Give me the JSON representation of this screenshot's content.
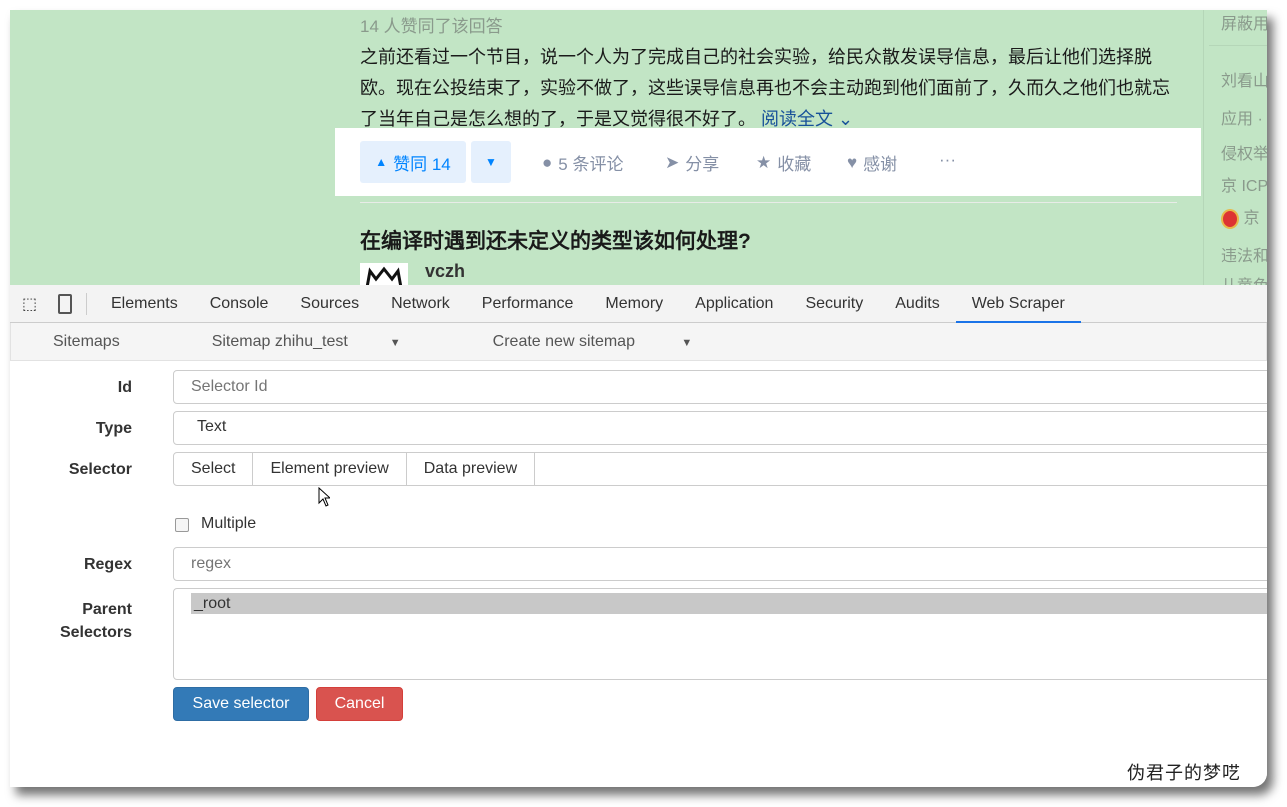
{
  "answer": {
    "likes_text": "14 人赞同了该回答",
    "excerpt": "之前还看过一个节目，说一个人为了完成自己的社会实验，给民众散发误导信息，最后让他们选择脱欧。现在公投结束了，实验不做了，这些误导信息再也不会主动跑到他们面前了，久而久之他们也就忘了当年自己是怎么想的了，于是又觉得很不好了。",
    "read_more": "阅读全文",
    "upvote_label": "赞同 14",
    "comments": "5 条评论",
    "share": "分享",
    "collect": "收藏",
    "thanks": "感谢",
    "more": "···"
  },
  "next_question": {
    "title": "在编译时遇到还未定义的类型该如何处理?",
    "author": "vczh"
  },
  "sidebar": [
    "屏蔽用",
    "刘看山",
    "应用 ·",
    "侵权举",
    "京 ICP",
    "京",
    "违法和",
    "儿童色"
  ],
  "devtools": {
    "tabs": [
      "Elements",
      "Console",
      "Sources",
      "Network",
      "Performance",
      "Memory",
      "Application",
      "Security",
      "Audits",
      "Web Scraper"
    ],
    "active_tab": "Web Scraper"
  },
  "scraper": {
    "nav": [
      "Sitemaps",
      "Sitemap zhihu_test",
      "Create new sitemap"
    ],
    "form": {
      "id_label": "Id",
      "id_placeholder": "Selector Id",
      "type_label": "Type",
      "type_value": "Text",
      "selector_label": "Selector",
      "selector_buttons": [
        "Select",
        "Element preview",
        "Data preview"
      ],
      "multiple_label": "Multiple",
      "multiple_checked": false,
      "regex_label": "Regex",
      "regex_placeholder": "regex",
      "parent_label_1": "Parent",
      "parent_label_2": "Selectors",
      "parent_options": [
        "_root"
      ],
      "save": "Save selector",
      "cancel": "Cancel"
    }
  },
  "watermark": {
    "text": "伪君子的梦呓"
  },
  "colors": {
    "page_bg": "#c2e5c5",
    "accent": "#0084ff",
    "save": "#337ab7",
    "cancel": "#d9534f"
  }
}
